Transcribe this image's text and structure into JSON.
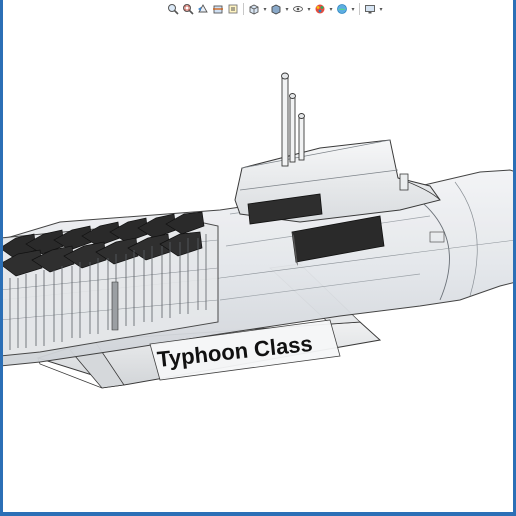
{
  "window": {
    "frame_color": "#2b6fb6",
    "background": "#ffffff"
  },
  "heads_up_toolbar": {
    "items": [
      {
        "icon": "zoom-to-fit-icon",
        "dropdown": false
      },
      {
        "icon": "zoom-to-area-icon",
        "dropdown": false
      },
      {
        "icon": "previous-view-icon",
        "dropdown": false
      },
      {
        "icon": "section-view-icon",
        "dropdown": false
      },
      {
        "icon": "dynamic-annotation-icon",
        "dropdown": false
      },
      {
        "icon": "view-orientation-icon",
        "dropdown": true
      },
      {
        "icon": "display-style-icon",
        "dropdown": true
      },
      {
        "icon": "hide-show-items-icon",
        "dropdown": true
      },
      {
        "icon": "edit-appearance-icon",
        "dropdown": true
      },
      {
        "icon": "apply-scene-icon",
        "dropdown": true
      },
      {
        "icon": "view-settings-icon",
        "dropdown": true
      }
    ]
  },
  "model": {
    "stand_label": "Typhoon Class",
    "label_color": "#111111",
    "line_color": "#3a3a3a",
    "missile_tube_color": "#2a2a2a"
  }
}
